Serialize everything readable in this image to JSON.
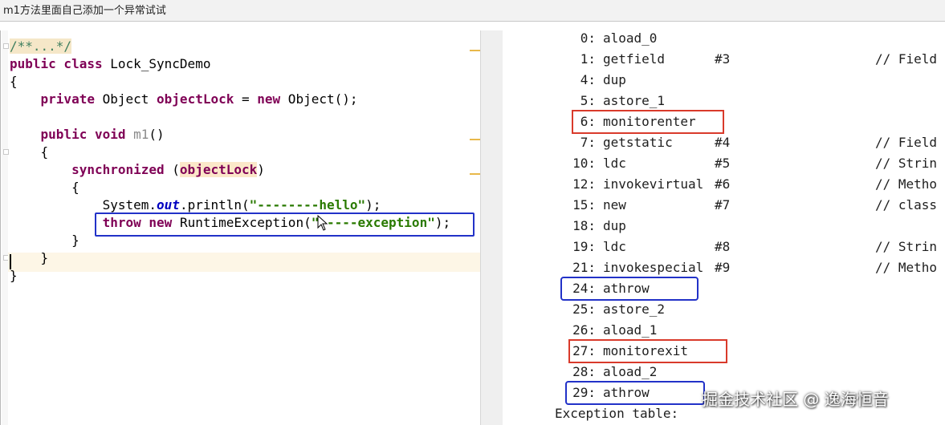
{
  "window": {
    "title": "m1方法里面自己添加一个异常试试"
  },
  "editor": {
    "comment": "/**...*/",
    "class_line": {
      "kw": "public class",
      "name": " Lock_SyncDemo"
    },
    "open_brace": "{",
    "field_line": {
      "kw": "private",
      "type": " Object ",
      "name": "objectLock",
      "eq": " = ",
      "new_kw": "new",
      "rest": " Object();"
    },
    "method_line": {
      "kw": "public void",
      "name": "m1",
      "rest": "()"
    },
    "method_open": "{",
    "sync_line": {
      "kw": "synchronized",
      "open": " (",
      "name": "objectLock",
      "close": ")"
    },
    "sync_open": "{",
    "print_line": {
      "obj": "System.",
      "field": "out",
      "call": ".println(",
      "str": "\"--------hello\"",
      "end": ");"
    },
    "throw_line": {
      "kw": "throw",
      "new_kw": "new",
      "cls": " RuntimeException(",
      "str": "\"-----exception\"",
      "end": ");"
    },
    "sync_close": "}",
    "method_close": "}",
    "class_close": "}"
  },
  "bytecode": {
    "lines": [
      {
        "off": "0:",
        "op": "aload_0",
        "arg": "",
        "cmt": ""
      },
      {
        "off": "1:",
        "op": "getfield",
        "arg": "#3",
        "cmt": "// Field"
      },
      {
        "off": "4:",
        "op": "dup",
        "arg": "",
        "cmt": ""
      },
      {
        "off": "5:",
        "op": "astore_1",
        "arg": "",
        "cmt": ""
      },
      {
        "off": "6:",
        "op": "monitorenter",
        "arg": "",
        "cmt": ""
      },
      {
        "off": "7:",
        "op": "getstatic",
        "arg": "#4",
        "cmt": "// Field"
      },
      {
        "off": "10:",
        "op": "ldc",
        "arg": "#5",
        "cmt": "// Strin"
      },
      {
        "off": "12:",
        "op": "invokevirtual",
        "arg": "#6",
        "cmt": "// Metho"
      },
      {
        "off": "15:",
        "op": "new",
        "arg": "#7",
        "cmt": "// class"
      },
      {
        "off": "18:",
        "op": "dup",
        "arg": "",
        "cmt": ""
      },
      {
        "off": "19:",
        "op": "ldc",
        "arg": "#8",
        "cmt": "// Strin"
      },
      {
        "off": "21:",
        "op": "invokespecial",
        "arg": "#9",
        "cmt": "// Metho"
      },
      {
        "off": "24:",
        "op": "athrow",
        "arg": "",
        "cmt": ""
      },
      {
        "off": "25:",
        "op": "astore_2",
        "arg": "",
        "cmt": ""
      },
      {
        "off": "26:",
        "op": "aload_1",
        "arg": "",
        "cmt": ""
      },
      {
        "off": "27:",
        "op": "monitorexit",
        "arg": "",
        "cmt": ""
      },
      {
        "off": "28:",
        "op": "aload_2",
        "arg": "",
        "cmt": ""
      },
      {
        "off": "29:",
        "op": "athrow",
        "arg": "",
        "cmt": ""
      }
    ],
    "exception_table": "Exception table:"
  },
  "watermark": "掘金技术社区 @ 逸海恒音",
  "colors": {
    "red_box": "#d93a2b",
    "blue_box": "#2232c8"
  }
}
